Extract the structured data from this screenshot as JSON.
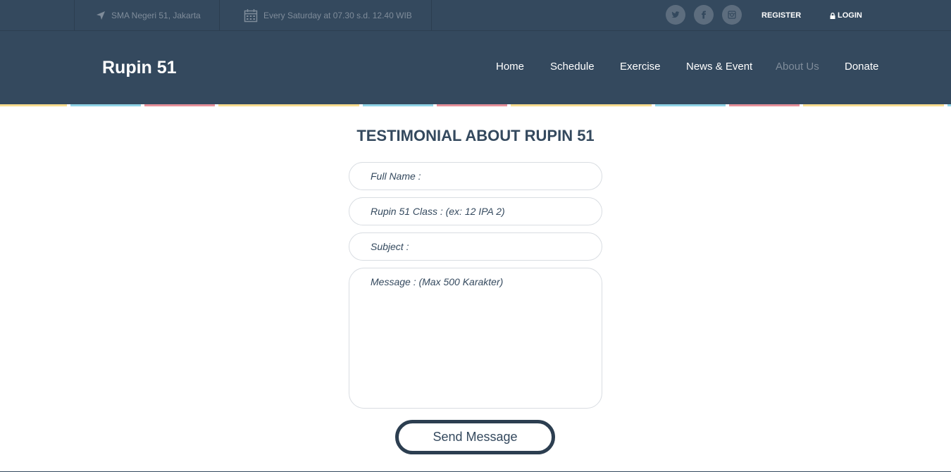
{
  "topbar": {
    "location": "SMA Negeri 51, Jakarta",
    "schedule": "Every Saturday at 07.30 s.d. 12.40 WIB",
    "register": "REGISTER",
    "login": "LOGIN",
    "social_icons": [
      "twitter-icon",
      "facebook-icon",
      "instagram-icon"
    ]
  },
  "navbar": {
    "brand": "Rupin 51",
    "items": [
      {
        "label": "Home"
      },
      {
        "label": "Schedule"
      },
      {
        "label": "Exercise"
      },
      {
        "label": "News & Event"
      },
      {
        "label": "About Us",
        "active": true
      },
      {
        "label": "Donate"
      }
    ]
  },
  "colors": {
    "primary": "#34495e",
    "stripe_yellow": "#f7dc8f",
    "stripe_blue": "#8fd3e6",
    "stripe_pink": "#e7909a"
  },
  "form": {
    "title": "TESTIMONIAL ABOUT RUPIN 51",
    "full_name_placeholder": "Full Name :",
    "class_placeholder": "Rupin 51 Class : (ex: 12 IPA 2)",
    "subject_placeholder": "Subject :",
    "message_placeholder": "Message : (Max 500 Karakter)",
    "submit_label": "Send Message"
  }
}
